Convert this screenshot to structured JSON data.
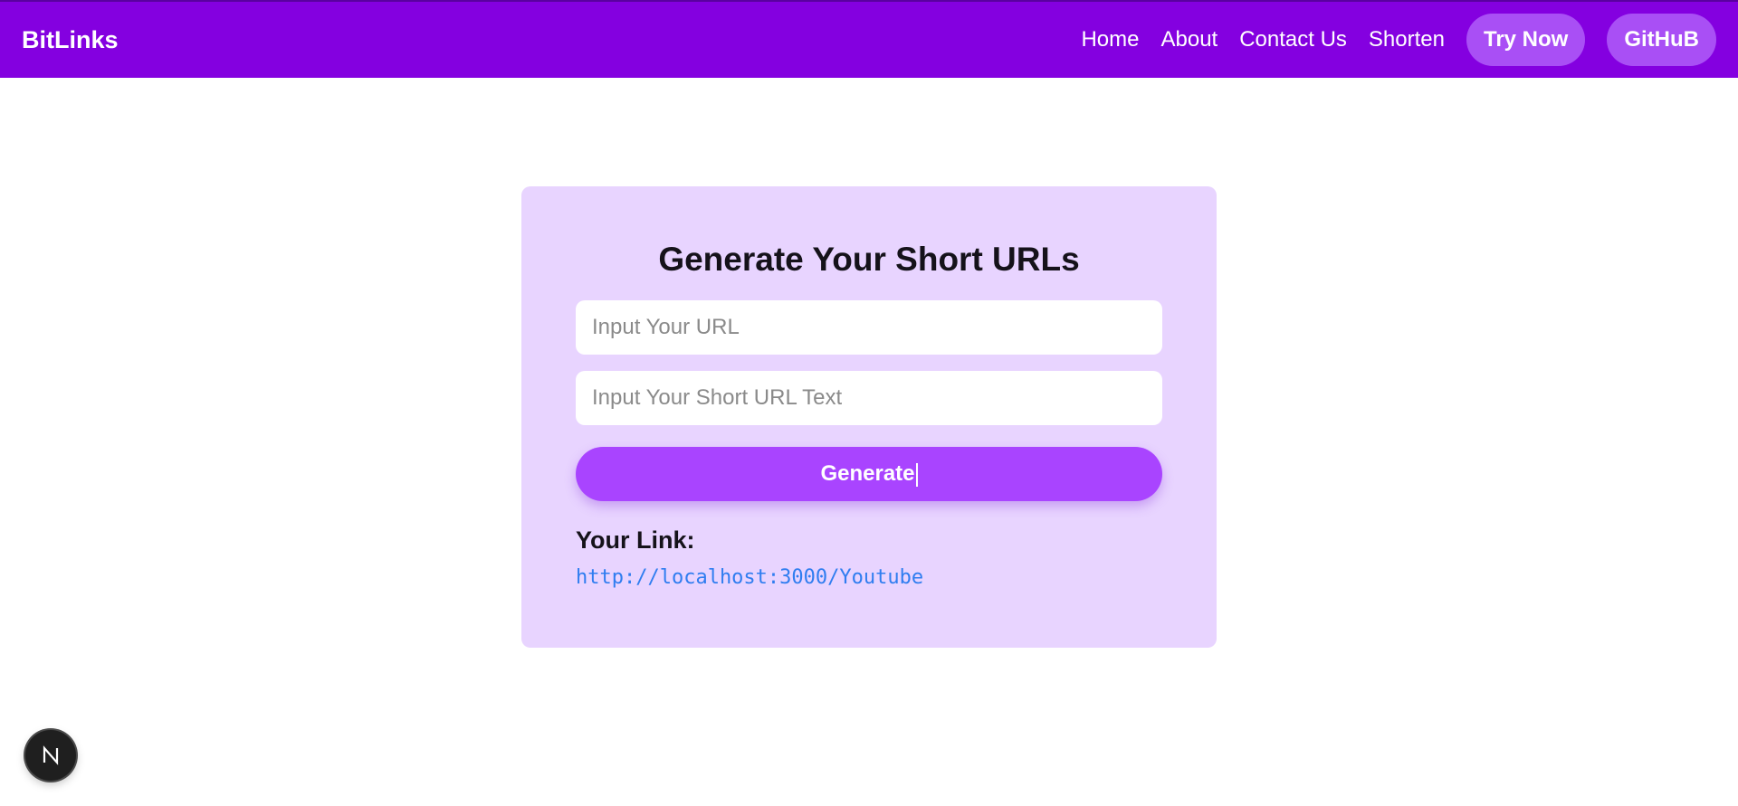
{
  "header": {
    "brand": "BitLinks",
    "nav": {
      "home": "Home",
      "about": "About",
      "contact": "Contact Us",
      "shorten": "Shorten"
    },
    "try_now": "Try Now",
    "github": "GitHuB",
    "bar_color": "#8400e0",
    "pill_color": "#a94ff5"
  },
  "card": {
    "title": "Generate Your Short URLs",
    "url_placeholder": "Input Your URL",
    "url_value": "",
    "short_placeholder": "Input Your Short URL Text",
    "short_value": "",
    "generate_label": "Generate",
    "link_label": "Your Link:",
    "link_value": "http://localhost:3000/Youtube",
    "background": "#e8d4ff",
    "button_color": "#a944ff",
    "link_color": "#2f7df0"
  },
  "dev_badge": {
    "icon": "nextjs-n-icon",
    "letter": "N"
  }
}
